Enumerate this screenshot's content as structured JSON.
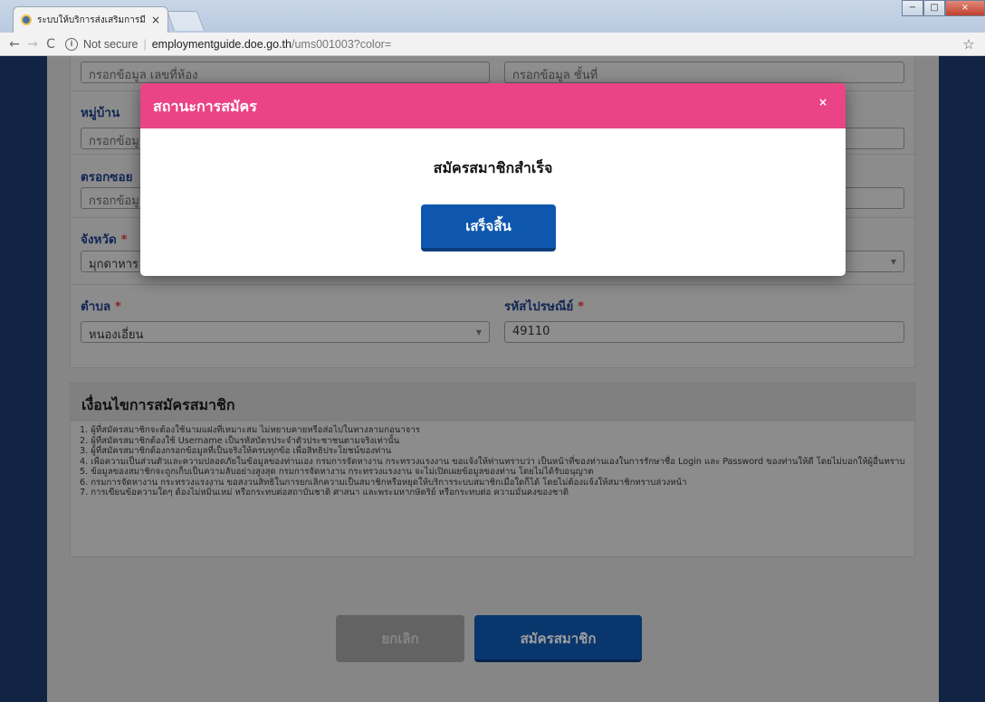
{
  "browser": {
    "tab_title": "ระบบให้บริการส่งเสริมการมีงาน",
    "tab_close": "×",
    "address_info": "i",
    "address_secure_label": "Not secure",
    "address_host": "employmentguide.doe.go.th",
    "address_path": "/ums001003?color=",
    "nav_back": "←",
    "nav_forward": "→",
    "nav_reload": "C",
    "bookmark_icon": "☆",
    "window_min": "−",
    "window_max": "□",
    "window_close": "×"
  },
  "form": {
    "room_placeholder": "กรอกข้อมูล เลขที่ห้อง",
    "floor_placeholder": "กรอกข้อมูล ชั้นที่",
    "village_label": "หมู่บ้าน",
    "village_placeholder": "กรอกข้อมูล",
    "soi_label": "ตรอกซอย",
    "soi_placeholder": "กรอกข้อมูล",
    "province_label": "จังหวัด",
    "province_value": "มุกดาหาร",
    "subdistrict_label": "ตำบล",
    "subdistrict_value": "หนองเอี่ยน",
    "postcode_label": "รหัสไปรษณีย์",
    "postcode_value": "49110",
    "required_mark": "*",
    "dropdown_caret": "▼"
  },
  "conditions": {
    "title": "เงื่อนไขการสมัครสมาชิก",
    "items": [
      "1. ผู้ที่สมัครสมาชิกจะต้องใช้นามแฝงที่เหมาะสม ไม่หยาบคายหรือส่อไปในทางลามกอนาจาร",
      "2. ผู้ที่สมัครสมาชิกต้องใช้ Username เป็นรหัสบัตรประจำตัวประชาชนตามจริงเท่านั้น",
      "3. ผู้ที่สมัครสมาชิกต้องกรอกข้อมูลที่เป็นจริงให้ครบทุกข้อ เพื่อสิทธิประโยชน์ของท่าน",
      "4. เพื่อความเป็นส่วนตัวและความปลอดภัยในข้อมูลของท่านเอง กรมการจัดหางาน กระทรวงแรงงาน ขอแจ้งให้ท่านทราบว่า เป็นหน้าที่ของท่านเองในการรักษาชื่อ Login และ Password ของท่านให้ดี โดยไม่บอกให้ผู้อื่นทราบ",
      "5. ข้อมูลของสมาชิกจะถูกเก็บเป็นความลับอย่างสูงสุด กรมการจัดหางาน กระทรวงแรงงาน จะไม่เปิดเผยข้อมูลของท่าน โดยไม่ได้รับอนุญาต",
      "6. กรมการจัดหางาน กระทรวงแรงงาน ขอสงวนสิทธิในการยกเลิกความเป็นสมาชิกหรือหยุดให้บริการระบบสมาชิกเมื่อใดก็ได้ โดยไม่ต้องแจ้งให้สมาชิกทราบล่วงหน้า",
      "7. การเขียนข้อความใดๆ ต้องไม่หมิ่นเหม่ หรือกระทบต่อสถาบันชาติ ศาสนา และพระมหากษัตริย์ หรือกระทบต่อ ความมั่นคงของชาติ"
    ]
  },
  "actions": {
    "cancel_label": "ยกเลิก",
    "submit_label": "สมัครสมาชิก"
  },
  "modal": {
    "title": "สถานะการสมัคร",
    "close": "×",
    "message": "สมัครสมาชิกสำเร็จ",
    "button_label": "เสร็จสิ้น"
  },
  "colors": {
    "modal_header": "#ea4386",
    "primary_button": "#0f57ae",
    "page_background": "#1d3b6d",
    "label_text": "#1f3f88"
  }
}
